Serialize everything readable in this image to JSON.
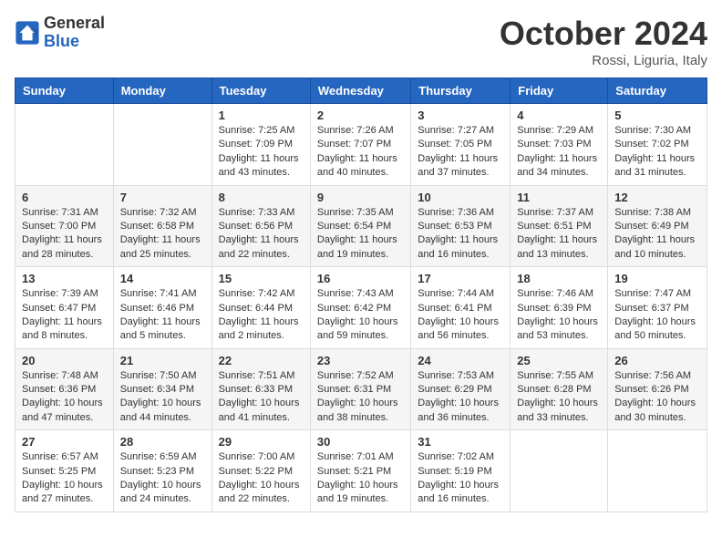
{
  "logo": {
    "general": "General",
    "blue": "Blue"
  },
  "title": {
    "month": "October 2024",
    "location": "Rossi, Liguria, Italy"
  },
  "headers": [
    "Sunday",
    "Monday",
    "Tuesday",
    "Wednesday",
    "Thursday",
    "Friday",
    "Saturday"
  ],
  "weeks": [
    [
      {
        "day": "",
        "content": ""
      },
      {
        "day": "",
        "content": ""
      },
      {
        "day": "1",
        "content": "Sunrise: 7:25 AM\nSunset: 7:09 PM\nDaylight: 11 hours and 43 minutes."
      },
      {
        "day": "2",
        "content": "Sunrise: 7:26 AM\nSunset: 7:07 PM\nDaylight: 11 hours and 40 minutes."
      },
      {
        "day": "3",
        "content": "Sunrise: 7:27 AM\nSunset: 7:05 PM\nDaylight: 11 hours and 37 minutes."
      },
      {
        "day": "4",
        "content": "Sunrise: 7:29 AM\nSunset: 7:03 PM\nDaylight: 11 hours and 34 minutes."
      },
      {
        "day": "5",
        "content": "Sunrise: 7:30 AM\nSunset: 7:02 PM\nDaylight: 11 hours and 31 minutes."
      }
    ],
    [
      {
        "day": "6",
        "content": "Sunrise: 7:31 AM\nSunset: 7:00 PM\nDaylight: 11 hours and 28 minutes."
      },
      {
        "day": "7",
        "content": "Sunrise: 7:32 AM\nSunset: 6:58 PM\nDaylight: 11 hours and 25 minutes."
      },
      {
        "day": "8",
        "content": "Sunrise: 7:33 AM\nSunset: 6:56 PM\nDaylight: 11 hours and 22 minutes."
      },
      {
        "day": "9",
        "content": "Sunrise: 7:35 AM\nSunset: 6:54 PM\nDaylight: 11 hours and 19 minutes."
      },
      {
        "day": "10",
        "content": "Sunrise: 7:36 AM\nSunset: 6:53 PM\nDaylight: 11 hours and 16 minutes."
      },
      {
        "day": "11",
        "content": "Sunrise: 7:37 AM\nSunset: 6:51 PM\nDaylight: 11 hours and 13 minutes."
      },
      {
        "day": "12",
        "content": "Sunrise: 7:38 AM\nSunset: 6:49 PM\nDaylight: 11 hours and 10 minutes."
      }
    ],
    [
      {
        "day": "13",
        "content": "Sunrise: 7:39 AM\nSunset: 6:47 PM\nDaylight: 11 hours and 8 minutes."
      },
      {
        "day": "14",
        "content": "Sunrise: 7:41 AM\nSunset: 6:46 PM\nDaylight: 11 hours and 5 minutes."
      },
      {
        "day": "15",
        "content": "Sunrise: 7:42 AM\nSunset: 6:44 PM\nDaylight: 11 hours and 2 minutes."
      },
      {
        "day": "16",
        "content": "Sunrise: 7:43 AM\nSunset: 6:42 PM\nDaylight: 10 hours and 59 minutes."
      },
      {
        "day": "17",
        "content": "Sunrise: 7:44 AM\nSunset: 6:41 PM\nDaylight: 10 hours and 56 minutes."
      },
      {
        "day": "18",
        "content": "Sunrise: 7:46 AM\nSunset: 6:39 PM\nDaylight: 10 hours and 53 minutes."
      },
      {
        "day": "19",
        "content": "Sunrise: 7:47 AM\nSunset: 6:37 PM\nDaylight: 10 hours and 50 minutes."
      }
    ],
    [
      {
        "day": "20",
        "content": "Sunrise: 7:48 AM\nSunset: 6:36 PM\nDaylight: 10 hours and 47 minutes."
      },
      {
        "day": "21",
        "content": "Sunrise: 7:50 AM\nSunset: 6:34 PM\nDaylight: 10 hours and 44 minutes."
      },
      {
        "day": "22",
        "content": "Sunrise: 7:51 AM\nSunset: 6:33 PM\nDaylight: 10 hours and 41 minutes."
      },
      {
        "day": "23",
        "content": "Sunrise: 7:52 AM\nSunset: 6:31 PM\nDaylight: 10 hours and 38 minutes."
      },
      {
        "day": "24",
        "content": "Sunrise: 7:53 AM\nSunset: 6:29 PM\nDaylight: 10 hours and 36 minutes."
      },
      {
        "day": "25",
        "content": "Sunrise: 7:55 AM\nSunset: 6:28 PM\nDaylight: 10 hours and 33 minutes."
      },
      {
        "day": "26",
        "content": "Sunrise: 7:56 AM\nSunset: 6:26 PM\nDaylight: 10 hours and 30 minutes."
      }
    ],
    [
      {
        "day": "27",
        "content": "Sunrise: 6:57 AM\nSunset: 5:25 PM\nDaylight: 10 hours and 27 minutes."
      },
      {
        "day": "28",
        "content": "Sunrise: 6:59 AM\nSunset: 5:23 PM\nDaylight: 10 hours and 24 minutes."
      },
      {
        "day": "29",
        "content": "Sunrise: 7:00 AM\nSunset: 5:22 PM\nDaylight: 10 hours and 22 minutes."
      },
      {
        "day": "30",
        "content": "Sunrise: 7:01 AM\nSunset: 5:21 PM\nDaylight: 10 hours and 19 minutes."
      },
      {
        "day": "31",
        "content": "Sunrise: 7:02 AM\nSunset: 5:19 PM\nDaylight: 10 hours and 16 minutes."
      },
      {
        "day": "",
        "content": ""
      },
      {
        "day": "",
        "content": ""
      }
    ]
  ]
}
